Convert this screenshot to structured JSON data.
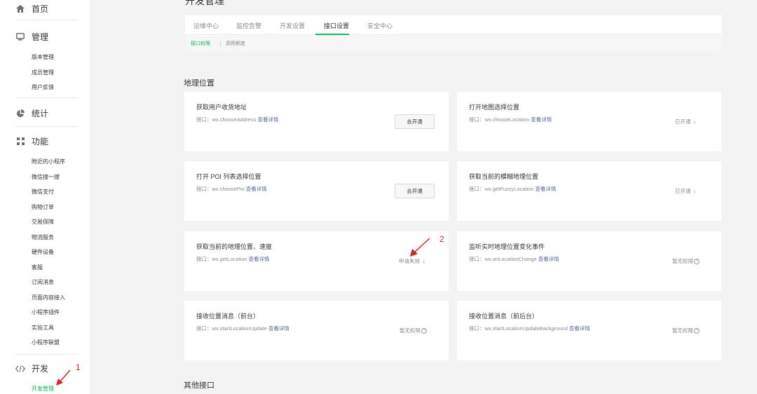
{
  "page": {
    "title": "开发管理"
  },
  "sidebar": {
    "home": "首页",
    "manage": {
      "label": "管理",
      "items": [
        "版本管理",
        "成员管理",
        "用户反馈"
      ]
    },
    "stats": "统计",
    "features": {
      "label": "功能",
      "items": [
        "附近的小程序",
        "微信搜一搜",
        "微信支付",
        "购物订单",
        "交易保障",
        "物流服务",
        "硬件设备",
        "客服",
        "订阅消息",
        "页面内容接入",
        "小程序插件",
        "实验工具",
        "小程序联盟"
      ]
    },
    "dev": {
      "label": "开发",
      "items": [
        "开发管理"
      ],
      "active": "开发管理"
    }
  },
  "tabs": [
    "运维中心",
    "监控告警",
    "开发设置",
    "接口设置",
    "安全中心"
  ],
  "active_tab": "接口设置",
  "subtabs": [
    "接口权限",
    "调用额度"
  ],
  "active_subtab": "接口权限",
  "sections": {
    "geo": "地理位置",
    "other": "其他接口"
  },
  "api_prefix": "接口：",
  "detail_link": "查看详情",
  "cards": [
    {
      "title": "获取用户收货地址",
      "api": "wx.chooseAddress",
      "action": "去开通"
    },
    {
      "title": "打开地图选择位置",
      "api": "wx.chooseLocation",
      "status": "已开通"
    },
    {
      "title": "打开 POI 列表选择位置",
      "api": "wx.choosePoi",
      "action": "去开通"
    },
    {
      "title": "获取当前的模糊地理位置",
      "api": "wx.getFuzzyLocation",
      "status": "已开通"
    },
    {
      "title": "获取当前的地理位置、速度",
      "api": "wx.getLocation",
      "status": "申请失效"
    },
    {
      "title": "监听实时地理位置变化事件",
      "api": "wx.onLocationChange",
      "status": "暂无权限"
    },
    {
      "title": "接收位置消息（前台）",
      "api": "wx.startLocationUpdate",
      "status": "暂无权限"
    },
    {
      "title": "接收位置消息（前后台）",
      "api": "wx.startLocationUpdateBackground",
      "status": "暂无权限"
    }
  ],
  "annotations": [
    "1",
    "2"
  ],
  "colors": {
    "accent": "#07c160",
    "link": "#576b95",
    "annotation": "#e02020"
  },
  "icons": {
    "home": "home-icon",
    "manage": "monitor-icon",
    "stats": "pie-chart-icon",
    "features": "grid-icon",
    "dev": "code-icon"
  }
}
